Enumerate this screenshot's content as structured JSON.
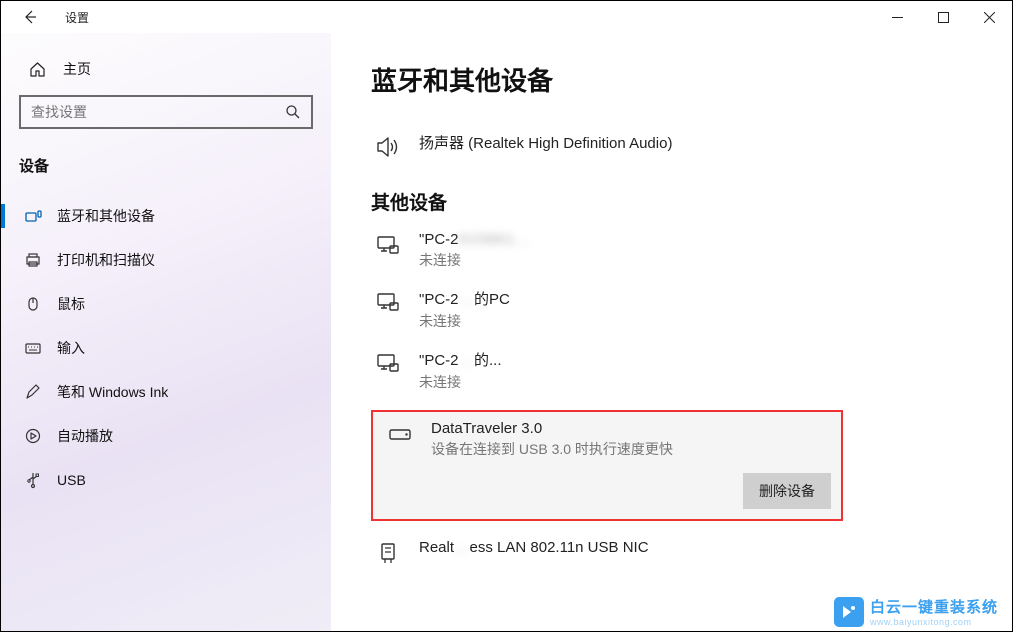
{
  "titlebar": {
    "title": "设置"
  },
  "sidebar": {
    "home": "主页",
    "search_placeholder": "查找设置",
    "category": "设备",
    "items": [
      {
        "label": "蓝牙和其他设备"
      },
      {
        "label": "打印机和扫描仪"
      },
      {
        "label": "鼠标"
      },
      {
        "label": "输入"
      },
      {
        "label": "笔和 Windows Ink"
      },
      {
        "label": "自动播放"
      },
      {
        "label": "USB"
      }
    ]
  },
  "page": {
    "title": "蓝牙和其他设备",
    "audio_device": "扬声器 (Realtek High Definition Audio)",
    "other_section": "其他设备",
    "others": [
      {
        "prefix": "\"PC-2",
        "blur": "015861...",
        "suffix": "",
        "status": "未连接"
      },
      {
        "prefix": "\"PC-2",
        "blur": "...",
        "suffix": "的PC",
        "status": "未连接"
      },
      {
        "prefix": "\"PC-2",
        "blur": "...",
        "suffix": "的...",
        "status": "未连接"
      }
    ],
    "selected": {
      "name": "DataTraveler 3.0",
      "desc": "设备在连接到 USB 3.0 时执行速度更快",
      "remove": "删除设备"
    },
    "realtek": {
      "prefix": "Realt",
      "blur": "...",
      "suffix": "ess LAN 802.11n USB NIC"
    }
  },
  "watermark": {
    "line1": "白云一键重装系统",
    "line2": "www.baiyunxitong.com"
  }
}
